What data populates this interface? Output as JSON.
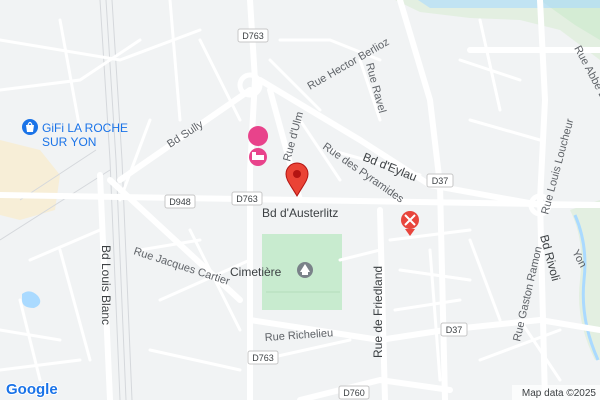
{
  "map": {
    "streets": {
      "bd_sully": "Bd Sully",
      "rue_hector_berlioz": "Rue Hector Berlioz",
      "rue_ravel": "Rue Ravel",
      "rue_dulm": "Rue d'Ulm",
      "rue_des_pyramides": "Rue des Pyramides",
      "bd_deylau": "Bd d'Eylau",
      "bd_daustertlitz": "Bd d'Austerlitz",
      "bd_louis_blanc": "Bd Louis Blanc",
      "rue_jacques_cartier": "Rue Jacques Cartier",
      "rue_richelieu": "Rue Richelieu",
      "rue_de_friedland": "Rue de Friedland",
      "rue_gaston_ramon": "Rue Gaston Ramon",
      "bd_rivoli": "Bd Rivoli",
      "rue_louis_loucheur": "Rue Louis Loucheur",
      "rue_abbe_lemire": "Rue Abbé Lemire",
      "yon": "Yon"
    },
    "road_shields": {
      "d763_top": "D763",
      "d763_mid": "D763",
      "d763_bottom": "D763",
      "d948": "D948",
      "d37_east": "D37",
      "d37_south": "D37",
      "d760": "D760"
    },
    "pois": {
      "gifi_line1": "GiFi LA ROCHE",
      "gifi_line2": "SUR YON",
      "cemetery": "Cimetière"
    },
    "attribution": {
      "google_logo": "Google",
      "map_data": "Map data ©2025"
    },
    "colors": {
      "marker": "#ea4335",
      "park": "#c8ebcf",
      "water": "#aadaff",
      "hotel_pin": "#e8438b",
      "restaurant_pin": "#e8453c",
      "shopping_pin": "#1a73e8"
    }
  }
}
